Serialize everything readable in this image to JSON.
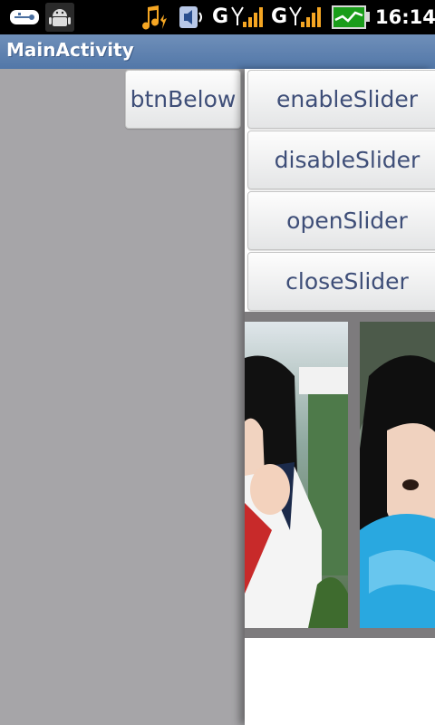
{
  "status_bar": {
    "icons": [
      "usb-icon",
      "android-debug-icon",
      "music-icon",
      "volume-icon",
      "signal-icon",
      "signal-icon",
      "battery-icon"
    ],
    "network1": "G",
    "network2": "G",
    "time": "16:14"
  },
  "title_bar": {
    "title": "MainActivity"
  },
  "main": {
    "btn_below_label": "btnBelow"
  },
  "slider": {
    "buttons": [
      {
        "label": "enableSlider"
      },
      {
        "label": "disableSlider"
      },
      {
        "label": "openSlider"
      },
      {
        "label": "closeSlider"
      }
    ]
  },
  "colors": {
    "background": "#a6a5a8",
    "title_bar": "#5277a8",
    "button_text": "#3e4e78",
    "gallery_bg": "#7d7b7d"
  }
}
